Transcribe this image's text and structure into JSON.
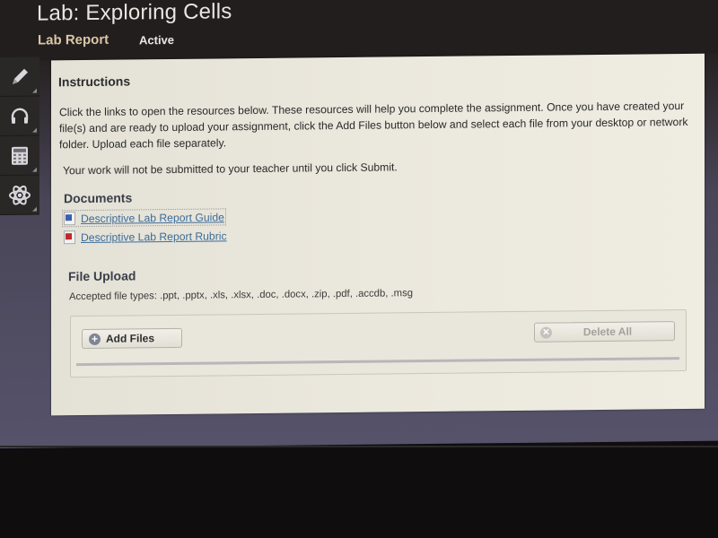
{
  "header": {
    "title": "Lab: Exploring Cells",
    "subtitle": "Lab Report",
    "status": "Active"
  },
  "toolbar": {
    "tools": [
      {
        "name": "pencil-icon",
        "label": "Highlighter"
      },
      {
        "name": "headphones-icon",
        "label": "Audio"
      },
      {
        "name": "calculator-icon",
        "label": "Calculator"
      },
      {
        "name": "atom-icon",
        "label": "Periodic Table"
      }
    ]
  },
  "instructions": {
    "heading": "Instructions",
    "body": "Click the links to open the resources below. These resources will help you complete the assignment. Once you have created your file(s) and are ready to upload your assignment, click the Add Files button below and select each file from your desktop or network folder. Upload each file separately.",
    "note": "Your work will not be submitted to your teacher until you click Submit."
  },
  "documents": {
    "heading": "Documents",
    "items": [
      {
        "label": "Descriptive Lab Report Guide",
        "icon": "word-doc-icon",
        "color": "#3b5fb0"
      },
      {
        "label": "Descriptive Lab Report Rubric",
        "icon": "pdf-icon",
        "color": "#c0282a"
      }
    ]
  },
  "file_upload": {
    "heading": "File Upload",
    "accepted": "Accepted file types: .ppt, .pptx, .xls, .xlsx, .doc, .docx, .zip, .pdf, .accdb, .msg",
    "add_label": "Add Files",
    "delete_label": "Delete All"
  }
}
